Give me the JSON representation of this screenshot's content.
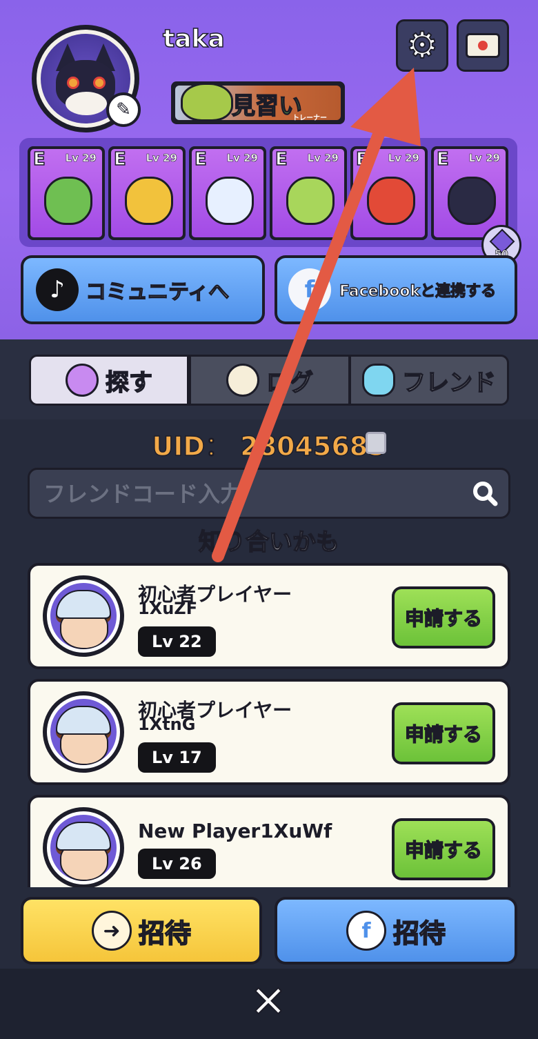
{
  "profile": {
    "username": "taka",
    "rank_label": "見習い",
    "rank_sub": "トレーナー"
  },
  "icons": {
    "settings": "gear-icon",
    "mail": "mail-icon",
    "edit": "edit-icon"
  },
  "team": [
    {
      "grade": "E",
      "level": "Lv 29",
      "color": "#6fbf52"
    },
    {
      "grade": "E",
      "level": "Lv 29",
      "color": "#f2c23c"
    },
    {
      "grade": "E",
      "level": "Lv 29",
      "color": "#e7f0ff"
    },
    {
      "grade": "E",
      "level": "Lv 29",
      "color": "#a8d65b"
    },
    {
      "grade": "E",
      "level": "Lv 29",
      "color": "#e24a37"
    },
    {
      "grade": "E",
      "level": "Lv 29",
      "color": "#2a2a44"
    }
  ],
  "gem_count": "50",
  "social": {
    "tiktok_label": "コミュニティへ",
    "facebook_label": "Facebookと連携する"
  },
  "tabs": [
    {
      "label": "探す",
      "active": true
    },
    {
      "label": "ログ",
      "active": false
    },
    {
      "label": "フレンド",
      "active": false
    }
  ],
  "uid": "UID： 28045685",
  "search": {
    "placeholder": "フレンドコード入力"
  },
  "suggest_title": "知り合いかも",
  "players": [
    {
      "name": "初心者プレイヤー",
      "id": "1XuZF",
      "level": "Lv 22",
      "action": "申請する"
    },
    {
      "name": "初心者プレイヤー",
      "id": "1XtnG",
      "level": "Lv 17",
      "action": "申請する"
    },
    {
      "name": "New Player1XuWf",
      "id": "",
      "level": "Lv 26",
      "action": "申請する"
    }
  ],
  "invite": {
    "invite_label": "招待",
    "facebook_invite_label": "招待"
  },
  "close_label": "✕"
}
